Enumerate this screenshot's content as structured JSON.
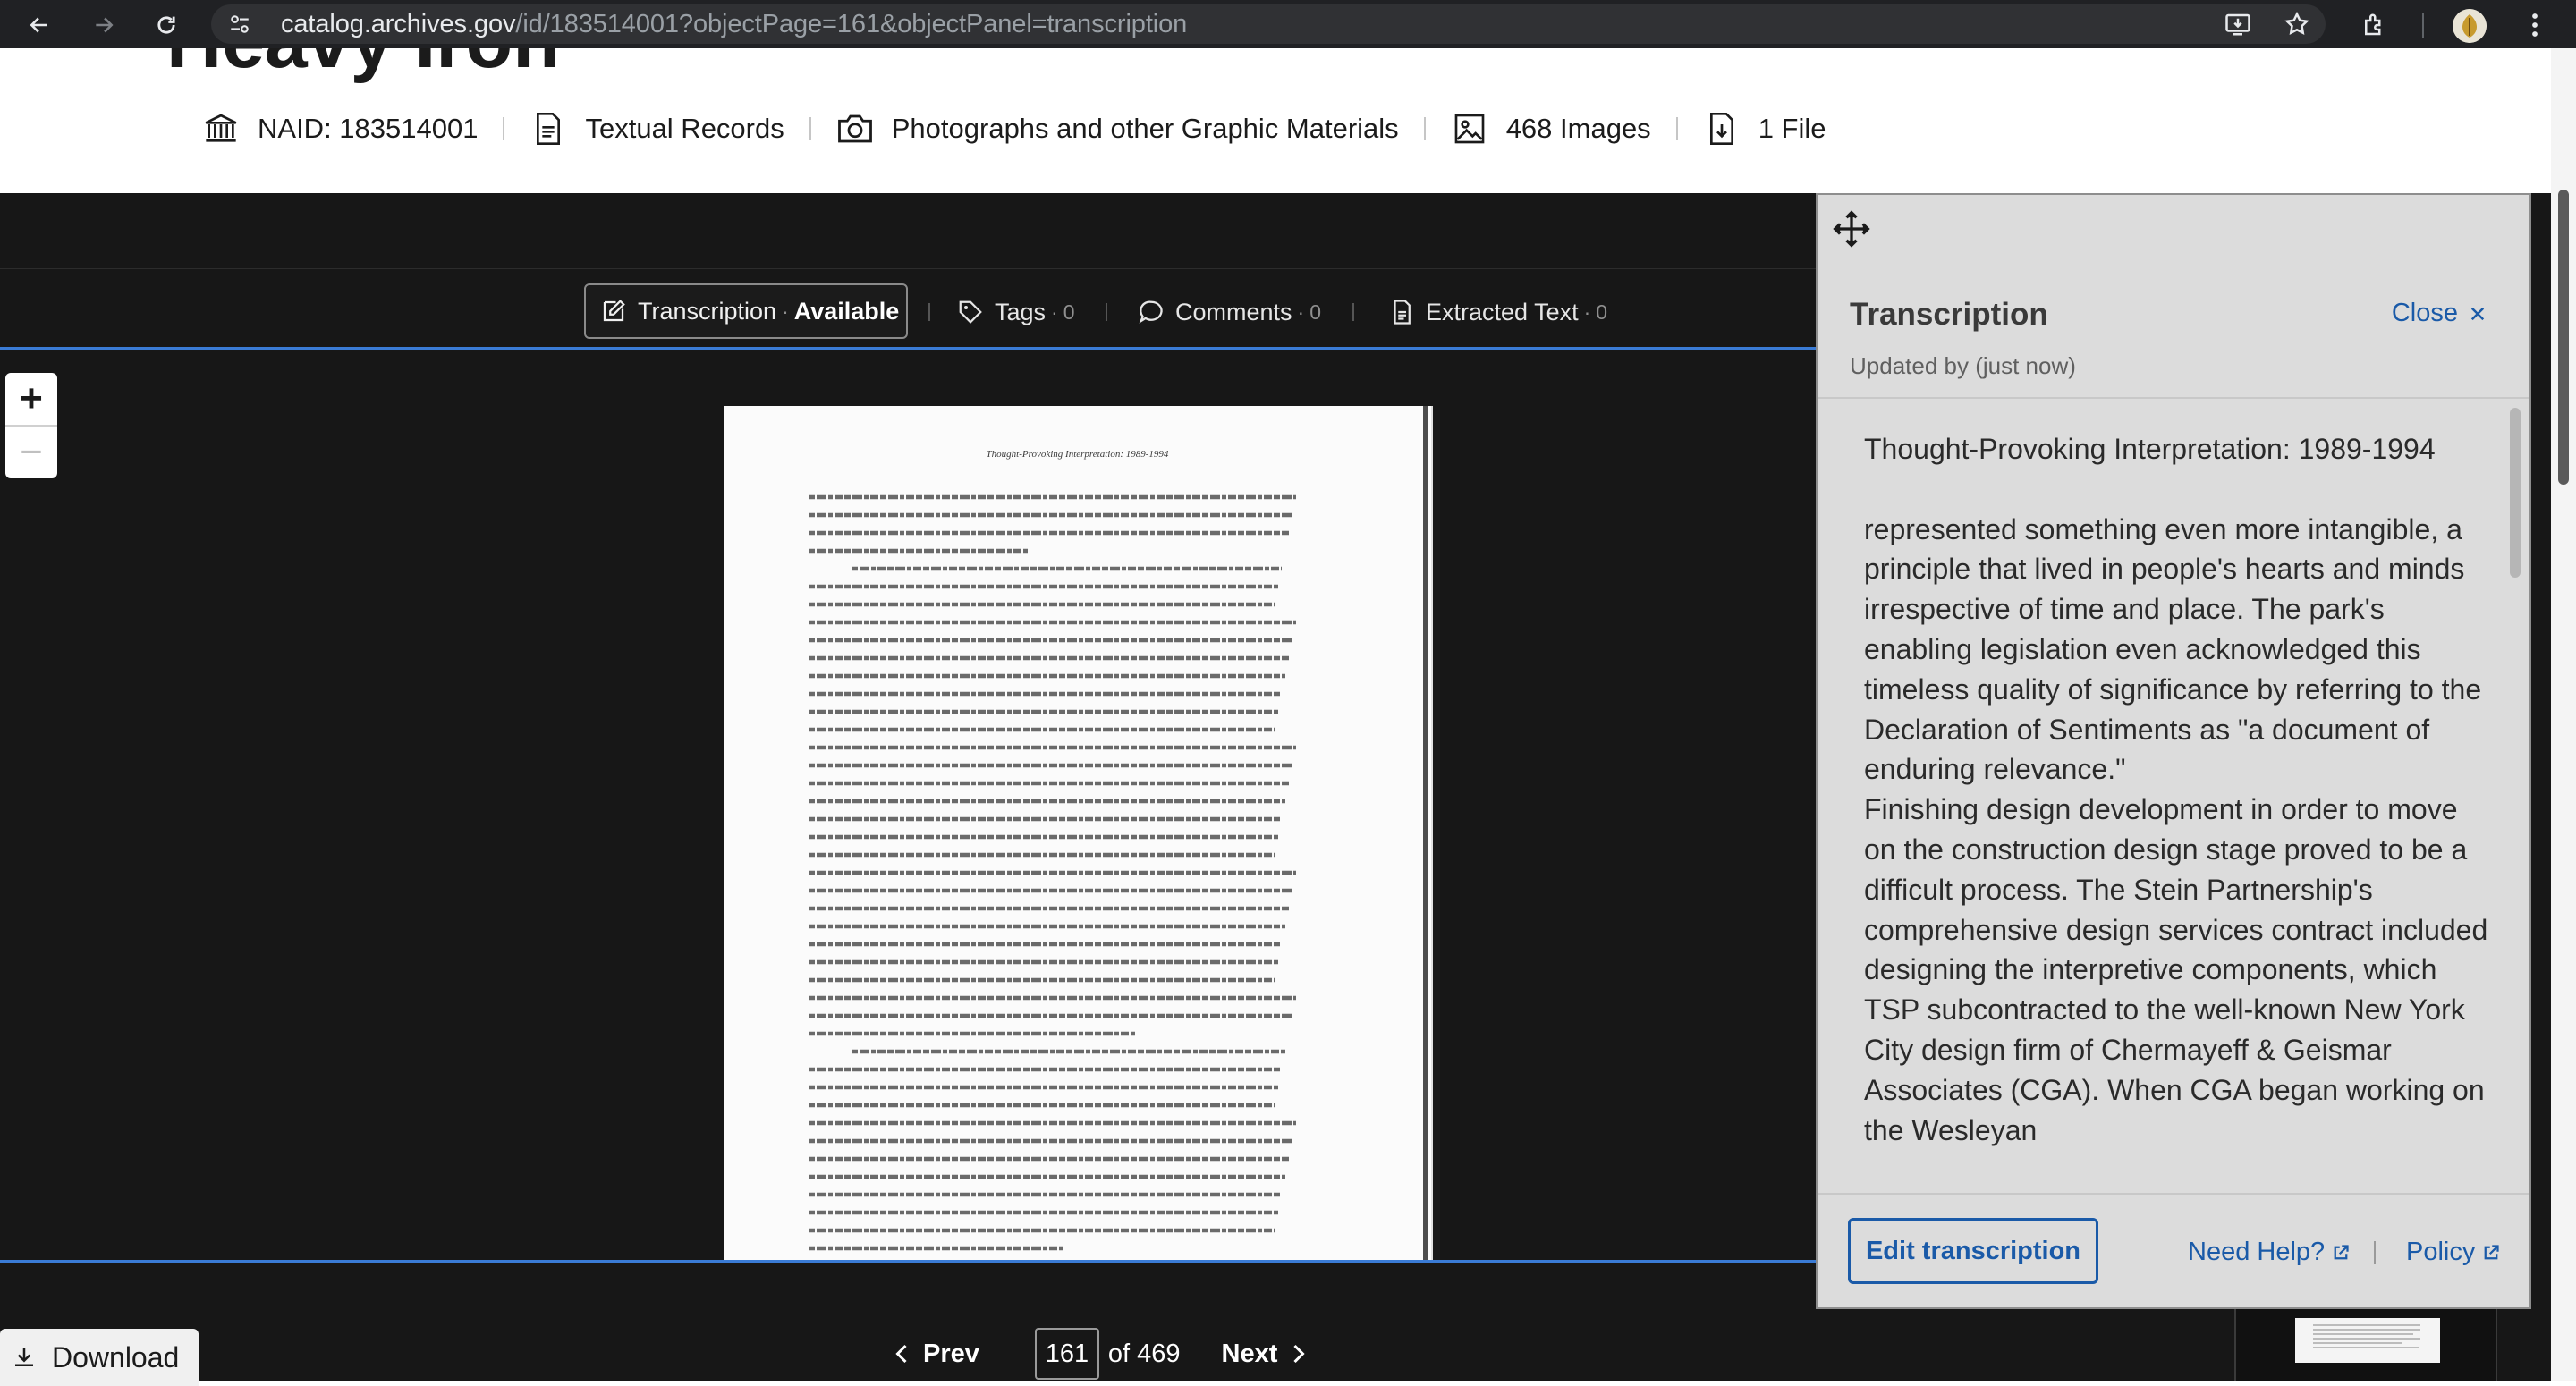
{
  "browser": {
    "url_domain": "catalog.archives.gov",
    "url_path": "/id/183514001?objectPage=161&objectPanel=transcription"
  },
  "record": {
    "title": "Heavy Iron",
    "meta": [
      {
        "icon": "building-icon",
        "label": "NAID: 183514001"
      },
      {
        "icon": "document-icon",
        "label": "Textual Records"
      },
      {
        "icon": "camera-icon",
        "label": "Photographs and other Graphic Materials"
      },
      {
        "icon": "image-icon",
        "label": "468 Images"
      },
      {
        "icon": "file-download-icon",
        "label": "1 File"
      }
    ]
  },
  "viewer": {
    "tabs": {
      "transcription_label": "Transcription",
      "transcription_status": "Available",
      "tags_label": "Tags",
      "tags_count": "0",
      "comments_label": "Comments",
      "comments_count": "0",
      "extracted_label": "Extracted Text",
      "extracted_count": "0"
    },
    "zoom_in": "+",
    "zoom_out": "−",
    "page_header": "Thought-Provoking Interpretation: 1989-1994",
    "download_label": "Download",
    "pager": {
      "prev": "Prev",
      "current": "161",
      "of_total": "of 469",
      "next": "Next"
    }
  },
  "panel": {
    "title": "Transcription",
    "close_label": "Close",
    "updated": "Updated by (just now)",
    "paragraphs": [
      "Thought-Provoking Interpretation: 1989-1994",
      "represented something even more intangible, a principle that lived in people's hearts and minds irrespective of time and place. The park's enabling legislation even acknowledged this timeless quality of significance by referring to the Declaration of Sentiments as \"a document of enduring relevance.\"",
      "Finishing design development in order to move on the construction design stage proved to be a difficult process. The Stein Partnership's comprehensive design services contract included designing the interpretive components, which TSP subcontracted to the well-known New York City design firm of Chermayeff & Geismar Associates (CGA). When CGA began working on the Wesleyan"
    ],
    "edit_label": "Edit transcription",
    "help_label": "Need Help?",
    "policy_label": "Policy"
  },
  "colors": {
    "link": "#1a5aa8",
    "viewer_bg": "#171717",
    "accent_line": "#3a7bd5"
  }
}
